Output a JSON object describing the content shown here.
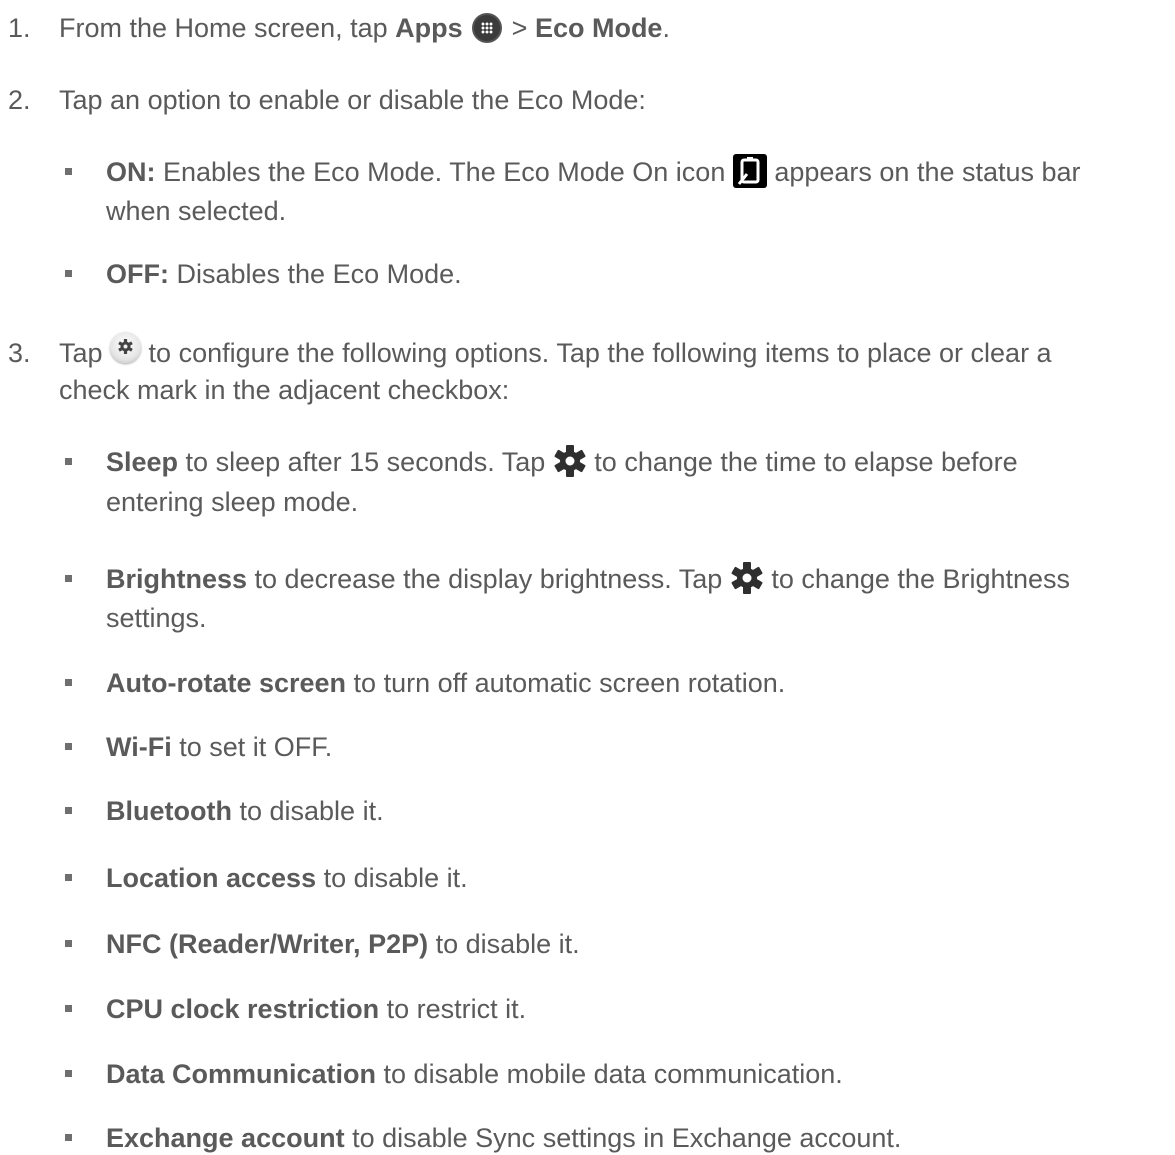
{
  "steps": [
    {
      "num": "1.",
      "t1": "From the Home screen, tap ",
      "b1": "Apps",
      "t2": " > ",
      "b2": "Eco Mode",
      "t3": ".",
      "icon": "apps-icon"
    },
    {
      "num": "2.",
      "text": "Tap an option to enable or disable the Eco Mode:"
    },
    {
      "num": "3.",
      "t1": "Tap ",
      "t2": " to configure the following options. Tap the following items to place or clear a",
      "line2": "check mark in the adjacent checkbox:",
      "icon": "gear-small-icon"
    }
  ],
  "mode_options": [
    {
      "bold": "ON:",
      "t1": " Enables the Eco Mode. The Eco Mode On icon ",
      "t2": " appears on the status bar",
      "line2": "when selected.",
      "icon": "eco-mode-icon"
    },
    {
      "bold": "OFF:",
      "text": " Disables the Eco Mode."
    }
  ],
  "settings_items": [
    {
      "bold": "Sleep",
      "t1": " to sleep after 15 seconds. Tap ",
      "t2": " to change the time to elapse before",
      "line2": "entering sleep mode.",
      "icon": "gear-icon"
    },
    {
      "bold": "Brightness",
      "t1": " to decrease the display brightness. Tap ",
      "t2": " to change the Brightness",
      "line2": "settings.",
      "icon": "gear-icon"
    },
    {
      "bold": "Auto-rotate screen",
      "text": " to turn off automatic screen rotation."
    },
    {
      "bold": "Wi-Fi",
      "text": " to set it OFF."
    },
    {
      "bold": "Bluetooth",
      "text": " to disable it."
    },
    {
      "bold": "Location access",
      "text": " to disable it."
    },
    {
      "bold": "NFC (Reader/Writer, P2P)",
      "text": " to disable it."
    },
    {
      "bold": "CPU clock restriction",
      "text": " to restrict it."
    },
    {
      "bold": "Data Communication",
      "text": " to disable mobile data communication."
    },
    {
      "bold": "Exchange account",
      "text": " to disable Sync settings in Exchange account."
    }
  ]
}
